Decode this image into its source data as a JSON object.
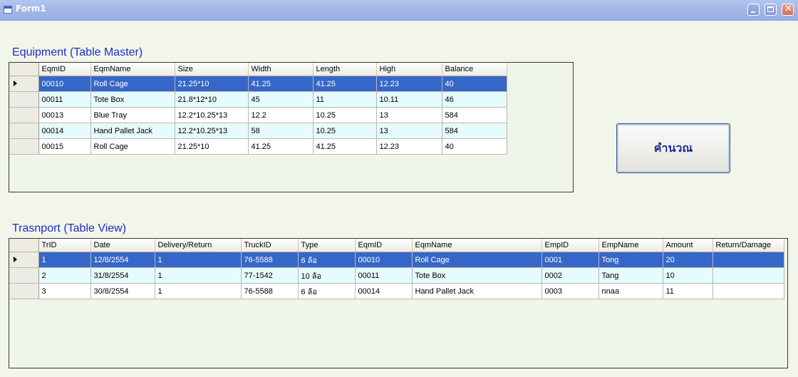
{
  "window": {
    "title": "Form1"
  },
  "equipment": {
    "title": "Equipment (Table Master)",
    "columns": [
      "EqmID",
      "EqmName",
      "Size",
      "Width",
      "Length",
      "High",
      "Balance"
    ],
    "rows": [
      [
        "00010",
        "Roll Cage",
        "21.25*10",
        "41.25",
        "41.25",
        "12.23",
        "40"
      ],
      [
        "00011",
        "Tote Box",
        "21.8*12*10",
        "45",
        "11",
        "10.11",
        "46"
      ],
      [
        "00013",
        "Blue Tray",
        "12.2*10.25*13",
        "12.2",
        "10.25",
        "13",
        "584"
      ],
      [
        "00014",
        "Hand Pallet Jack",
        "12.2*10.25*13",
        "58",
        "10.25",
        "13",
        "584"
      ],
      [
        "00015",
        "Roll Cage",
        "21.25*10",
        "41.25",
        "41.25",
        "12.23",
        "40"
      ]
    ]
  },
  "transport": {
    "title": "Trasnport (Table View)",
    "columns": [
      "TrID",
      "Date",
      "Delivery/Return",
      "TruckID",
      "Type",
      "EqmID",
      "EqmName",
      "EmpID",
      "EmpName",
      "Amount",
      "Return/Damage"
    ],
    "rows": [
      [
        "1",
        "12/8/2554",
        "1",
        "76-5588",
        "6 ล้อ",
        "00010",
        "Roll Cage",
        "0001",
        "Tong",
        "20",
        ""
      ],
      [
        "2",
        "31/8/2554",
        "1",
        "77-1542",
        "10 ล้อ",
        "00011",
        "Tote Box",
        "0002",
        "Tang",
        "10",
        ""
      ],
      [
        "3",
        "30/8/2554",
        "1",
        "76-5588",
        "6 ล้อ",
        "00014",
        "Hand Pallet Jack",
        "0003",
        "nnaa",
        "11",
        ""
      ]
    ]
  },
  "calculate_button": {
    "label": "คำนวณ"
  },
  "colors": {
    "selection": "#3667c8",
    "alt_row": "#e6fbfc",
    "title_text": "#1a2ec8"
  }
}
